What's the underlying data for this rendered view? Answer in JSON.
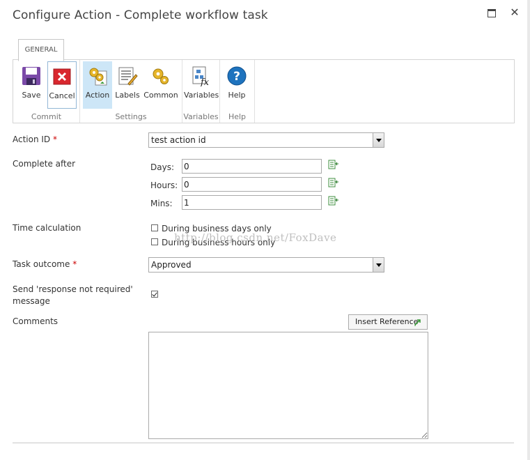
{
  "dialog": {
    "title": "Configure Action - Complete workflow task",
    "maximize_symbol": "□",
    "close_symbol": "✕"
  },
  "ribbon": {
    "tab": "GENERAL",
    "groups": [
      {
        "label": "Commit",
        "buttons": [
          {
            "label": "Save",
            "icon": "save-icon"
          },
          {
            "label": "Cancel",
            "icon": "cancel-icon"
          }
        ]
      },
      {
        "label": "Settings",
        "buttons": [
          {
            "label": "Action",
            "icon": "action-gears-icon"
          },
          {
            "label": "Labels",
            "icon": "labels-icon"
          },
          {
            "label": "Common",
            "icon": "common-gears-icon"
          }
        ]
      },
      {
        "label": "Variables",
        "buttons": [
          {
            "label": "Variables",
            "icon": "variables-fx-icon"
          }
        ]
      },
      {
        "label": "Help",
        "buttons": [
          {
            "label": "Help",
            "icon": "help-icon"
          }
        ]
      }
    ]
  },
  "form": {
    "action_id": {
      "label": "Action ID",
      "required_mark": "*",
      "value": "test action id"
    },
    "complete_after": {
      "label": "Complete after",
      "days": {
        "label": "Days:",
        "value": "0"
      },
      "hours": {
        "label": "Hours:",
        "value": "0"
      },
      "mins": {
        "label": "Mins:",
        "value": "1"
      }
    },
    "time_calculation": {
      "label": "Time calculation",
      "options": [
        {
          "label": "During business days only",
          "checked": false
        },
        {
          "label": "During business hours only",
          "checked": false
        }
      ]
    },
    "task_outcome": {
      "label": "Task outcome",
      "required_mark": "*",
      "value": "Approved"
    },
    "send_response": {
      "label_line1": "Send 'response not required'",
      "label_line2": "message",
      "checked": true
    },
    "comments": {
      "label": "Comments",
      "insert_reference": "Insert Reference",
      "value": ""
    }
  },
  "watermark": "http://blog.csdn.net/FoxDave"
}
